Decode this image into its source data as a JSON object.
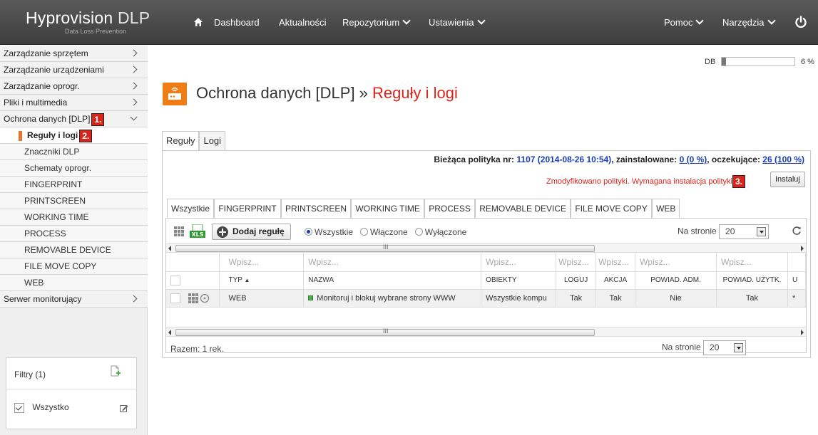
{
  "brand": {
    "name": "Hyprovision",
    "name_suffix": "DLP",
    "tagline": "Data Loss Prevention"
  },
  "nav": {
    "dashboard": "Dashboard",
    "news": "Aktualności",
    "repository": "Repozytorium",
    "settings": "Ustawienia",
    "help": "Pomoc",
    "tools": "Narzędzia"
  },
  "sidebar": {
    "items": [
      {
        "label": "Zarządzanie sprzętem"
      },
      {
        "label": "Zarządzanie urządzeniami"
      },
      {
        "label": "Zarządzanie oprogr."
      },
      {
        "label": "Pliki i multimedia"
      },
      {
        "label": "Ochrona danych [DLP]",
        "badge": "1."
      }
    ],
    "active": {
      "label": "Reguły i logi",
      "badge": "2."
    },
    "subitems": [
      "Znaczniki DLP",
      "Schematy oprogr.",
      "FINGERPRINT",
      "PRINTSCREEN",
      "WORKING TIME",
      "PROCESS",
      "REMOVABLE DEVICE",
      "FILE MOVE COPY",
      "WEB"
    ],
    "monitor": "Serwer monitorujący",
    "filters": {
      "title": "Filtry (1)",
      "item": "Wszystko"
    }
  },
  "db": {
    "label": "DB",
    "percent_text": "6 %",
    "percent": 0.06
  },
  "page": {
    "title_prefix": "Ochrona danych [DLP] » ",
    "title_current": "Reguły i logi"
  },
  "tabs": [
    "Reguły",
    "Logi"
  ],
  "policy": {
    "current_label": "Bieżąca polityka nr:",
    "current_value": "1107 (2014-08-26 10:54)",
    "installed_label": ", zainstalowane:",
    "installed_value": "0 (0 %)",
    "pending_label": ", oczekujące:",
    "pending_value": "26 (100 %)",
    "modified_msg": "Zmodyfikowano polityki. Wymagana instalacja polityki",
    "install_badge": "3.",
    "install_button": "Instaluj"
  },
  "rule_tabs": [
    "Wszystkie",
    "FINGERPRINT",
    "PRINTSCREEN",
    "WORKING TIME",
    "PROCESS",
    "REMOVABLE DEVICE",
    "FILE MOVE COPY",
    "WEB"
  ],
  "toolbar": {
    "add_label": "Dodaj regułę",
    "radio_all": "Wszystkie",
    "radio_on": "Włączone",
    "radio_off": "Wyłączone",
    "per_page_label": "Na stronie",
    "per_page_value": "20"
  },
  "grid": {
    "filter_placeholder": "Wpisz...",
    "filter_short": "Wpisz...",
    "columns": [
      "TYP",
      "NAZWA",
      "OBIEKTY",
      "LOGUJ",
      "AKCJA",
      "POWIAD. ADM.",
      "POWIAD. UŻYTK.",
      "U"
    ],
    "rows": [
      {
        "type": "WEB",
        "name": "Monitoruj i blokuj wybrane strony WWW",
        "objects": "Wszystkie kompu",
        "log": "Tak",
        "action": "Tak",
        "notify_admin": "Nie",
        "notify_user": "Tak",
        "extra": "*"
      }
    ]
  },
  "footer": {
    "total": "Razem: 1 rek.",
    "per_page_label": "Na stronie",
    "per_page_value": "20"
  }
}
